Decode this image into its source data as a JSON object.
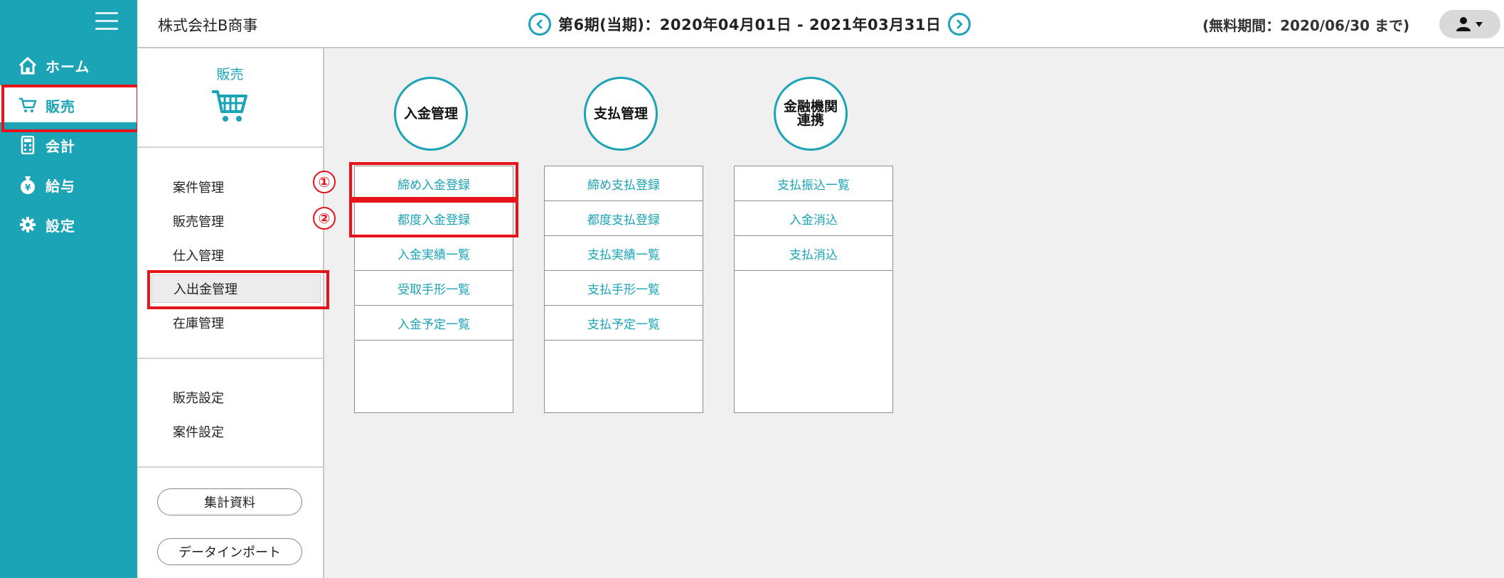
{
  "header": {
    "company": "株式会社B商事",
    "period": "第6期(当期)：2020年04月01日 - 2021年03月31日",
    "trial": "(無料期間：2020/06/30 まで)"
  },
  "nav": [
    {
      "label": "ホーム",
      "icon": "home-icon"
    },
    {
      "label": "販売",
      "icon": "cart-icon"
    },
    {
      "label": "会計",
      "icon": "calculator-icon"
    },
    {
      "label": "給与",
      "icon": "money-bag-icon"
    },
    {
      "label": "設定",
      "icon": "gear-icon"
    }
  ],
  "subpanel": {
    "title": "販売",
    "items": [
      "案件管理",
      "販売管理",
      "仕入管理",
      "入出金管理",
      "在庫管理"
    ],
    "settings": [
      "販売設定",
      "案件設定"
    ],
    "buttons": [
      "集計資料",
      "データインポート"
    ]
  },
  "columns": [
    {
      "title": "入金管理",
      "items": [
        "締め入金登録",
        "都度入金登録",
        "入金実績一覧",
        "受取手形一覧",
        "入金予定一覧"
      ]
    },
    {
      "title": "支払管理",
      "items": [
        "締め支払登録",
        "都度支払登録",
        "支払実績一覧",
        "支払手形一覧",
        "支払予定一覧"
      ]
    },
    {
      "title": "金融機関連携",
      "title_line1": "金融機関",
      "title_line2": "連携",
      "items": [
        "支払振込一覧",
        "入金消込",
        "支払消込"
      ]
    }
  ],
  "markers": [
    "①",
    "②"
  ],
  "colors": {
    "accent": "#1ba3b6",
    "highlight": "#e6131b"
  }
}
